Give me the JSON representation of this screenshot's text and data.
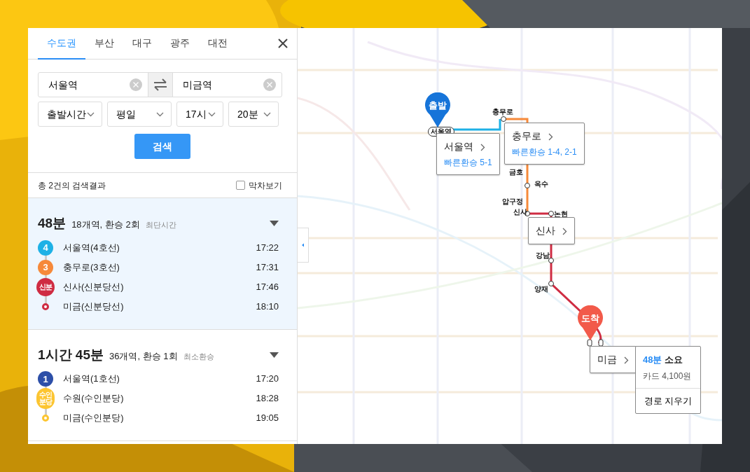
{
  "tabs": [
    {
      "label": "수도권",
      "selected": true
    },
    {
      "label": "부산",
      "selected": false
    },
    {
      "label": "대구",
      "selected": false
    },
    {
      "label": "광주",
      "selected": false
    },
    {
      "label": "대전",
      "selected": false
    }
  ],
  "from": {
    "value": "서울역"
  },
  "to": {
    "value": "미금역"
  },
  "selects": [
    {
      "value": "출발시간"
    },
    {
      "value": "평일"
    },
    {
      "value": "17시"
    },
    {
      "value": "20분"
    }
  ],
  "search_button": "검색",
  "result_count": "총 2건의 검색결과",
  "last_train": {
    "label": "막차보기",
    "checked": false
  },
  "routes": [
    {
      "duration": "48분",
      "summary": "18개역, 환승 2회",
      "tag": "최단시간",
      "selected": true,
      "steps": [
        {
          "kind": "badge",
          "badge": "4",
          "color": "#1eb1e6",
          "station": "서울역(4호선)",
          "time": "17:22"
        },
        {
          "kind": "badge",
          "badge": "3",
          "color": "#f6893a",
          "station": "충무로(3호선)",
          "time": "17:31"
        },
        {
          "kind": "badge",
          "badge": "신분",
          "color": "#cf2c42",
          "station": "신사(신분당선)",
          "time": "17:46"
        },
        {
          "kind": "end",
          "color": "#cf2c42",
          "station": "미금(신분당선)",
          "time": "18:10"
        }
      ]
    },
    {
      "duration": "1시간 45분",
      "summary": "36개역, 환승 1회",
      "tag": "최소환승",
      "selected": false,
      "steps": [
        {
          "kind": "badge",
          "badge": "1",
          "color": "#2d4fa8",
          "station": "서울역(1호선)",
          "time": "17:20"
        },
        {
          "kind": "badge",
          "badge": "수인분당",
          "color": "#fcc531",
          "station": "수원(수인분당)",
          "time": "18:28"
        },
        {
          "kind": "end",
          "color": "#fcc531",
          "station": "미금(수인분당)",
          "time": "19:05"
        }
      ]
    }
  ],
  "map": {
    "labels": [
      "서울역",
      "충무로",
      "금호",
      "옥수",
      "압구정",
      "신사",
      "논현",
      "강남",
      "양재"
    ],
    "markers": [
      {
        "kind": "start",
        "label": "출발"
      },
      {
        "kind": "end",
        "label": "도착"
      }
    ],
    "popups": [
      {
        "name": "서울역",
        "transfer": "빠른환승 5-1"
      },
      {
        "name": "충무로",
        "transfer": "빠른환승 1-4, 2-1"
      },
      {
        "name": "신사"
      },
      {
        "name": "미금"
      }
    ],
    "summary": {
      "duration": "48분",
      "suffix": "소요",
      "fare": "카드 4,100원",
      "clear_button": "경로 지우기"
    }
  }
}
